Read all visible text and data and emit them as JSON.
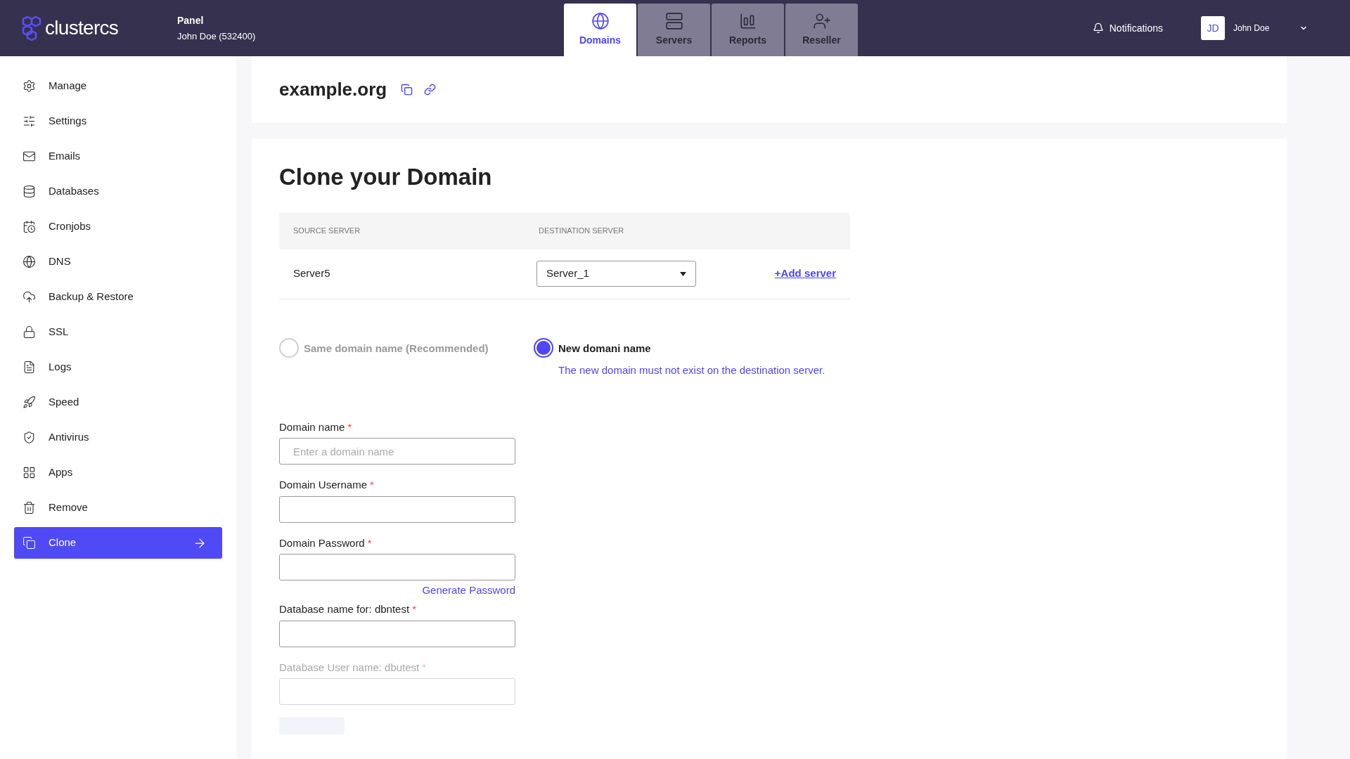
{
  "header": {
    "brand": "clustercs",
    "panel_title": "Panel",
    "account": "John Doe (532400)",
    "tabs": [
      {
        "label": "Domains",
        "selected": true
      },
      {
        "label": "Servers",
        "selected": false
      },
      {
        "label": "Reports",
        "selected": false
      },
      {
        "label": "Reseller",
        "selected": false
      }
    ],
    "notifications": "Notifications",
    "user": {
      "initials": "JD",
      "name": "John Doe"
    }
  },
  "sidebar": {
    "items": [
      {
        "label": "Manage",
        "selected": false
      },
      {
        "label": "Settings",
        "selected": false
      },
      {
        "label": "Emails",
        "selected": false
      },
      {
        "label": "Databases",
        "selected": false
      },
      {
        "label": "Cronjobs",
        "selected": false
      },
      {
        "label": "DNS",
        "selected": false
      },
      {
        "label": "Backup & Restore",
        "selected": false
      },
      {
        "label": "SSL",
        "selected": false
      },
      {
        "label": "Logs",
        "selected": false
      },
      {
        "label": "Speed",
        "selected": false
      },
      {
        "label": "Antivirus",
        "selected": false
      },
      {
        "label": "Apps",
        "selected": false
      },
      {
        "label": "Remove",
        "selected": false
      },
      {
        "label": "Clone",
        "selected": true
      }
    ]
  },
  "domain": "example.org",
  "clone": {
    "title": "Clone your Domain",
    "table": {
      "columns": [
        "SOURCE SERVER",
        "DESTINATION SERVER"
      ],
      "source": "Server5",
      "destination": "Server_1",
      "add_link": "+Add server"
    },
    "options": [
      {
        "label": "Same domain name (Recommended)",
        "selected": false
      },
      {
        "label": "New domani name",
        "selected": true,
        "note": "The new domain must not exist on the destination server."
      }
    ],
    "fields": [
      {
        "label": "Domain name",
        "required_mark": "*",
        "placeholder": "Enter a domain name",
        "faded": false
      },
      {
        "label": "Domain Username",
        "required_mark": "*",
        "faded": false
      },
      {
        "label": "Domain Password",
        "required_mark": "*",
        "faded": false,
        "link": "Generate Password"
      },
      {
        "label": "Database name for: dbntest",
        "required_mark": "*",
        "faded": false
      },
      {
        "label": "Database User name: dbutest",
        "required_mark": "*",
        "faded": true
      }
    ]
  }
}
